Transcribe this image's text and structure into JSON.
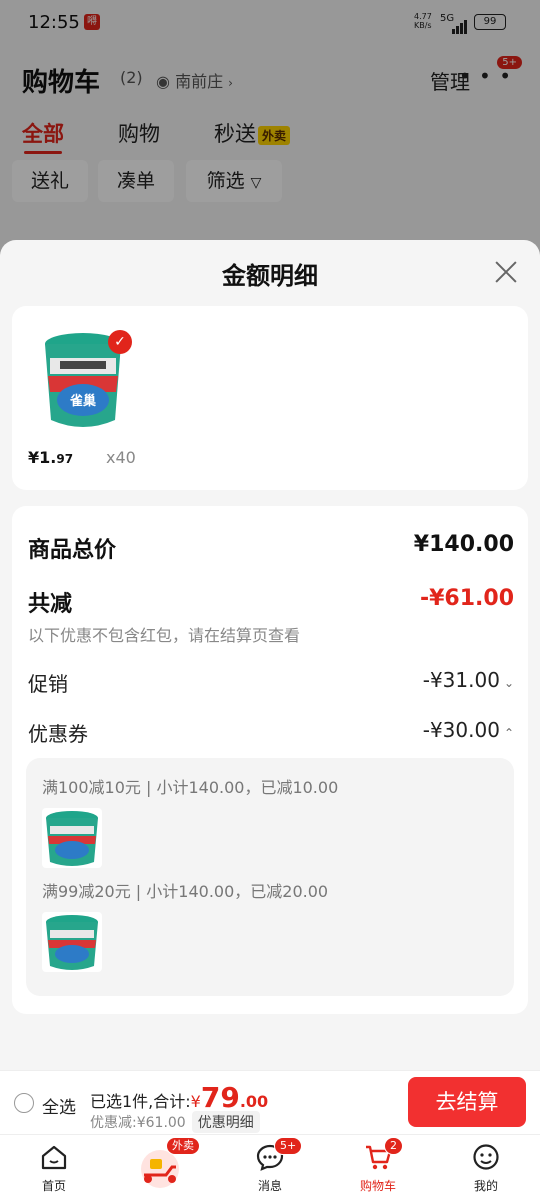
{
  "status_bar": {
    "time": "12:55",
    "app_badge": "嘚",
    "net_speed": "4.77",
    "net_unit": "KB/s",
    "signal": "5G",
    "battery": "99"
  },
  "header": {
    "title": "购物车",
    "count": "(2)",
    "location": "南前庄",
    "manage": "管理",
    "more_badge": "5+"
  },
  "tabs": [
    {
      "label": "全部"
    },
    {
      "label": "购物"
    },
    {
      "label": "秒送",
      "tag": "外卖"
    }
  ],
  "chips": [
    {
      "label": "送礼"
    },
    {
      "label": "凑单"
    },
    {
      "label": "筛选"
    }
  ],
  "sheet": {
    "title": "金额明细",
    "product": {
      "price_int": "¥1.",
      "price_dec": "97",
      "qty": "x40"
    },
    "total_label": "商品总价",
    "total_value": "¥140.00",
    "reduce_label": "共减",
    "reduce_value": "-¥61.00",
    "note": "以下优惠不包含红包，请在结算页查看",
    "promo_label": "促销",
    "promo_value": "-¥31.00",
    "coupon_label": "优惠券",
    "coupon_value": "-¥30.00",
    "coupons": [
      {
        "text": "满100减10元 | 小计140.00，已减10.00"
      },
      {
        "text": "满99减20元 | 小计140.00，已减20.00"
      }
    ]
  },
  "bottom_bar": {
    "select_all": "全选",
    "selected_text": "已选1件,合计:",
    "currency": "¥",
    "amount": "79",
    "amount_dec": ".00",
    "discount_text": "优惠减:¥61.00",
    "detail_button": "优惠明细",
    "checkout": "去结算"
  },
  "tabbar": [
    {
      "label": "首页"
    },
    {
      "label": "",
      "badge": "外卖"
    },
    {
      "label": "消息",
      "badge": "5+"
    },
    {
      "label": "购物车",
      "badge": "2"
    },
    {
      "label": "我的"
    }
  ],
  "colors": {
    "accent": "#e1251b",
    "checkout": "#f23030"
  }
}
